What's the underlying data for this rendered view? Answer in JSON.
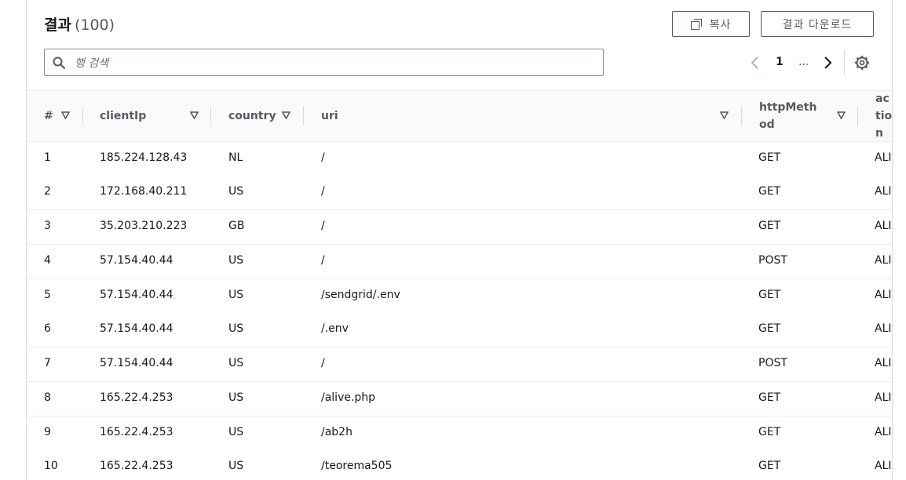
{
  "header": {
    "title": "결과",
    "count": "(100)",
    "copy_label": "복사",
    "download_label": "결과 다운로드"
  },
  "search": {
    "placeholder": "행 검색",
    "value": ""
  },
  "pagination": {
    "current_page": "1",
    "ellipsis": "..."
  },
  "table": {
    "columns": [
      "#",
      "clientIp",
      "country",
      "uri",
      "httpMethod",
      "action"
    ],
    "rows": [
      {
        "num": "1",
        "clientIp": "185.224.128.43",
        "country": "NL",
        "uri": "/",
        "method": "GET",
        "action": "ALI"
      },
      {
        "num": "2",
        "clientIp": "172.168.40.211",
        "country": "US",
        "uri": "/",
        "method": "GET",
        "action": "ALI"
      },
      {
        "num": "3",
        "clientIp": "35.203.210.223",
        "country": "GB",
        "uri": "/",
        "method": "GET",
        "action": "ALI"
      },
      {
        "num": "4",
        "clientIp": "57.154.40.44",
        "country": "US",
        "uri": "/",
        "method": "POST",
        "action": "ALI"
      },
      {
        "num": "5",
        "clientIp": "57.154.40.44",
        "country": "US",
        "uri": "/sendgrid/.env",
        "method": "GET",
        "action": "ALI"
      },
      {
        "num": "6",
        "clientIp": "57.154.40.44",
        "country": "US",
        "uri": "/.env",
        "method": "GET",
        "action": "ALI"
      },
      {
        "num": "7",
        "clientIp": "57.154.40.44",
        "country": "US",
        "uri": "/",
        "method": "POST",
        "action": "ALI"
      },
      {
        "num": "8",
        "clientIp": "165.22.4.253",
        "country": "US",
        "uri": "/alive.php",
        "method": "GET",
        "action": "ALI"
      },
      {
        "num": "9",
        "clientIp": "165.22.4.253",
        "country": "US",
        "uri": "/ab2h",
        "method": "GET",
        "action": "ALI"
      },
      {
        "num": "10",
        "clientIp": "165.22.4.253",
        "country": "US",
        "uri": "/teorema505",
        "method": "GET",
        "action": "ALI"
      }
    ]
  },
  "colors": {
    "text": "#16191f",
    "muted": "#545b64",
    "border": "#eaeded",
    "header_bg": "#fafafa"
  }
}
